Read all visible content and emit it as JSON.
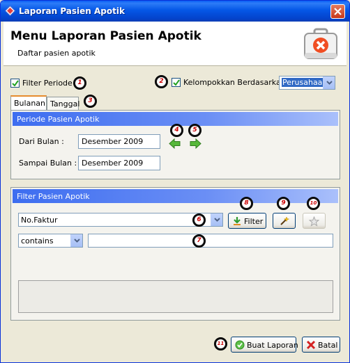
{
  "window": {
    "title": "Laporan Pasien Apotik"
  },
  "header": {
    "title": "Menu Laporan Pasien Apotik",
    "subtitle": "Daftar pasien apotik"
  },
  "options": {
    "filter_periode": {
      "label": "Filter Periode",
      "checked": true
    },
    "kelompokkan": {
      "label": "Kelompokkan Berdasarkan :",
      "checked": true,
      "selected": "Perusahaan"
    }
  },
  "tabs": [
    {
      "label": "Bulanan",
      "active": true
    },
    {
      "label": "Tanggal",
      "active": false
    }
  ],
  "periode": {
    "header": "Periode Pasien Apotik",
    "dari_label": "Dari Bulan :",
    "dari_value": "Desember 2009",
    "sampai_label": "Sampai Bulan :",
    "sampai_value": "Desember 2009"
  },
  "filter": {
    "header": "Filter Pasien Apotik",
    "field_selected": "No.Faktur",
    "operator_selected": "contains",
    "value": "",
    "filter_label": "Filter"
  },
  "footer": {
    "ok_label": "Buat Laporan",
    "cancel_label": "Batal"
  },
  "badges": [
    "1",
    "2",
    "3",
    "4",
    "5",
    "6",
    "7",
    "8",
    "9",
    "10",
    "11"
  ],
  "colors": {
    "accent": "#0554e3",
    "group_header": "#3d6df0"
  }
}
